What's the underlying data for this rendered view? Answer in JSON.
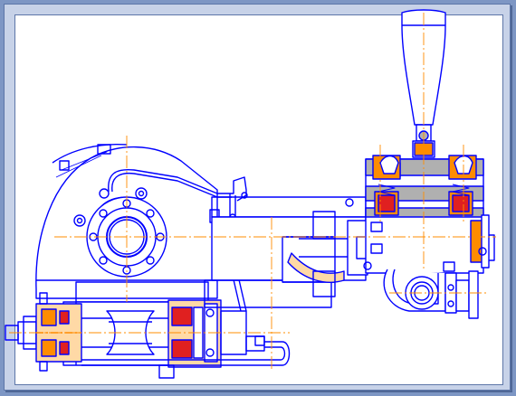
{
  "drawing": {
    "subject": "",
    "colors": {
      "outline": "#0000ff",
      "centerline": "#ff8c00",
      "section_fill": "#ff8c00",
      "seal_red": "#e02020",
      "housing_tan": "#ffd9a6",
      "shaded_gray": "#b0b0b0",
      "frame": "#7d96c4",
      "sheet": "#ffffff"
    }
  }
}
